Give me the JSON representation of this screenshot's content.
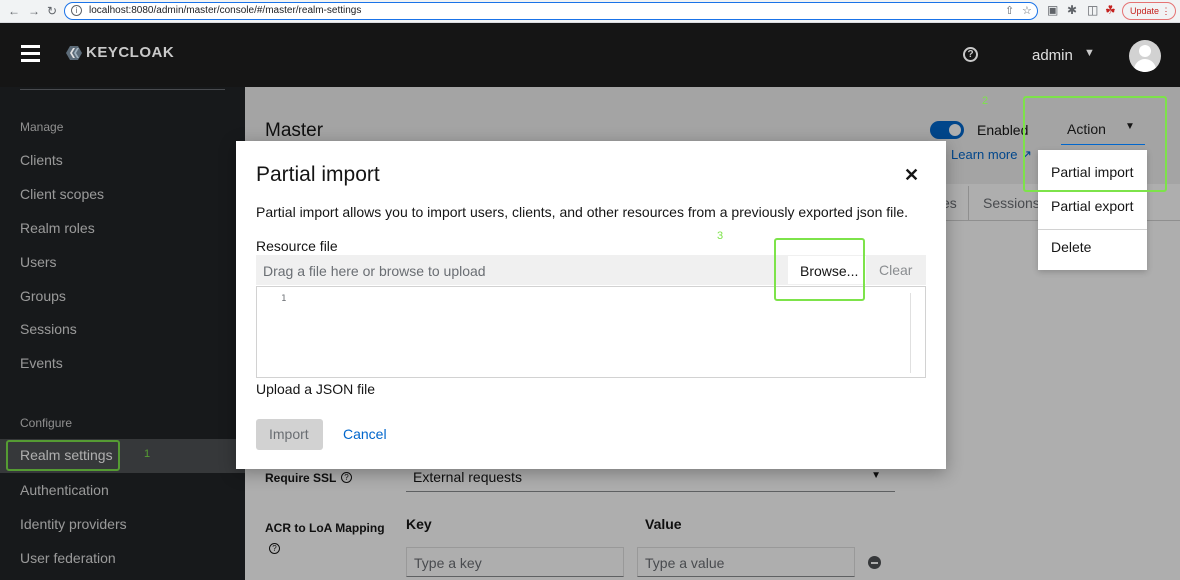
{
  "browser": {
    "url": "localhost:8080/admin/master/console/#/master/realm-settings",
    "update_label": "Update"
  },
  "header": {
    "logo_text": "KEYCLOAK",
    "user_name": "admin"
  },
  "sidebar": {
    "manage_label": "Manage",
    "configure_label": "Configure",
    "manage_items": [
      {
        "label": "Clients"
      },
      {
        "label": "Client scopes"
      },
      {
        "label": "Realm roles"
      },
      {
        "label": "Users"
      },
      {
        "label": "Groups"
      },
      {
        "label": "Sessions"
      },
      {
        "label": "Events"
      }
    ],
    "configure_items": [
      {
        "label": "Realm settings"
      },
      {
        "label": "Authentication"
      },
      {
        "label": "Identity providers"
      },
      {
        "label": "User federation"
      }
    ]
  },
  "annotations": {
    "a1": "1",
    "a2": "2",
    "a3": "3"
  },
  "page": {
    "title": "Master",
    "enabled_label": "Enabled",
    "learn_more": "Learn more",
    "action_label": "Action",
    "action_menu": [
      "Partial import",
      "Partial export",
      "Delete"
    ],
    "tabs": [
      "es",
      "Sessions"
    ]
  },
  "form": {
    "require_ssl_label": "Require SSL",
    "require_ssl_value": "External requests",
    "acr_label": "ACR to LoA Mapping",
    "key_header": "Key",
    "value_header": "Value",
    "key_placeholder": "Type a key",
    "value_placeholder": "Type a value"
  },
  "modal": {
    "title": "Partial import",
    "description": "Partial import allows you to import users, clients, and other resources from a previously exported json file.",
    "resource_file_label": "Resource file",
    "file_placeholder": "Drag a file here or browse to upload",
    "browse_label": "Browse...",
    "clear_label": "Clear",
    "line_number": "1",
    "helper_text": "Upload a JSON file",
    "import_label": "Import",
    "cancel_label": "Cancel"
  }
}
